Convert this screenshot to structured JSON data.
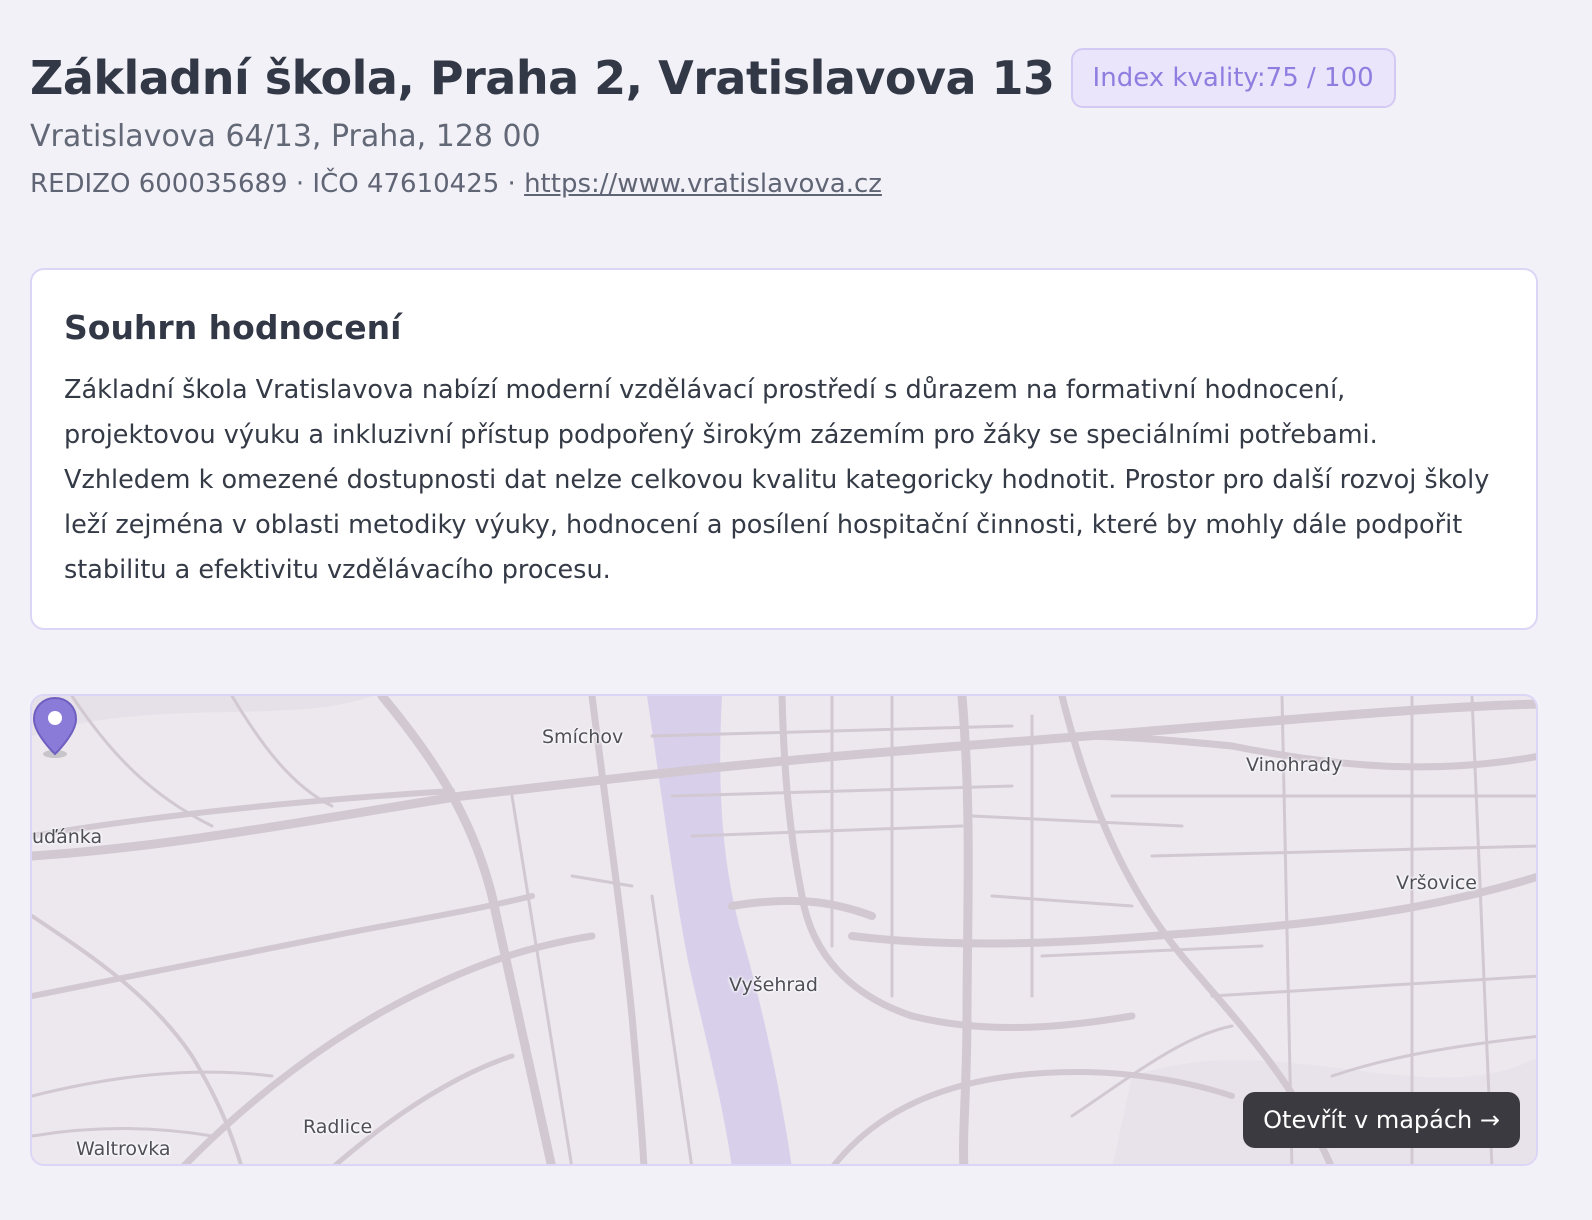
{
  "school": {
    "name": "Základní škola, Praha 2, Vratislavova 13",
    "quality_badge": "Index kvality:75 / 100",
    "address": "Vratislavova 64/13, Praha, 128 00",
    "ids_text": "REDIZO 600035689 · IČO 47610425 · ",
    "website": "https://www.vratislavova.cz"
  },
  "summary": {
    "heading": "Souhrn hodnocení",
    "text": "Základní škola Vratislavova nabízí moderní vzdělávací prostředí s důrazem na formativní hodnocení, projektovou výuku a inkluzivní přístup podpořený širokým zázemím pro žáky se speciálními potřebami. Vzhledem k omezené dostupnosti dat nelze celkovou kvalitu kategoricky hodnotit. Prostor pro další rozvoj školy leží zejména v oblasti metodiky výuky, hodnocení a posílení hospitační činnosti, které by mohly dále podpořit stabilitu a efektivitu vzdělávacího procesu."
  },
  "map": {
    "places": {
      "smichov": "Smíchov",
      "vinohrady": "Vinohrady",
      "budanka": "uďánka",
      "vrsovice": "Vršovice",
      "vysehrad": "Vyšehrad",
      "radlice": "Radlice",
      "waltrovka": "Waltrovka"
    },
    "open_button": "Otevřít v mapách →",
    "colors": {
      "pin": "#8b7bd8",
      "river": "#d8d0ea",
      "road": "#d2c8d2"
    }
  }
}
